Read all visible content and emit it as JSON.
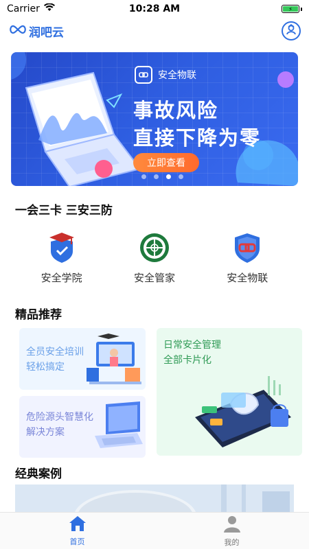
{
  "status_bar": {
    "carrier": "Carrier",
    "time": "10:28 AM"
  },
  "header": {
    "logo_text": "润吧云",
    "logo_icon": "infinity-logo-icon",
    "profile_icon": "profile-badge-icon"
  },
  "banner": {
    "brand": "安全物联",
    "headline_1": "事故风险",
    "headline_2": "直接下降为零",
    "cta": "立即查看",
    "dots": 4,
    "active_dot": 3
  },
  "section_1": {
    "title": "一会三卡   三安三防"
  },
  "features": [
    {
      "label": "安全学院",
      "icon": "graduation-shield-icon"
    },
    {
      "label": "安全管家",
      "icon": "emblem-icon"
    },
    {
      "label": "安全物联",
      "icon": "link-shield-icon"
    }
  ],
  "section_2": {
    "title": "精品推荐"
  },
  "recommend": {
    "card_1": {
      "line1": "全员安全培训",
      "line2": "轻松搞定"
    },
    "card_2": {
      "line1": "危险源头智慧化",
      "line2": "解决方案"
    },
    "card_3": {
      "line1": "日常安全管理",
      "line2": "全部卡片化"
    }
  },
  "section_3": {
    "title": "经典案例"
  },
  "tabbar": [
    {
      "label": "首页",
      "icon": "home-icon",
      "active": true
    },
    {
      "label": "我的",
      "icon": "user-icon",
      "active": false
    }
  ],
  "colors": {
    "primary": "#2f6fe0",
    "banner": "#2e5de0",
    "cta": "#ff7a33",
    "card_green": "#eafaf0",
    "card_blue": "#eef4ff"
  }
}
